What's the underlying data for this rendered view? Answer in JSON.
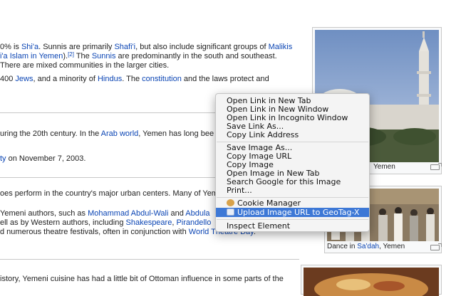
{
  "article": {
    "religion": {
      "l1_a": "0% is ",
      "l1_shia": "Shi'a",
      "l1_b": ". Sunnis are primarily ",
      "l1_shafii": "Shafi'i",
      "l1_c": ", but also include significant groups of ",
      "l1_malikis": "Malikis",
      "l2_link": "i'a Islam in Yemen",
      "l2_a": ").",
      "l2_ref": "[2]",
      "l2_b": " The ",
      "l2_sunnis": "Sunnis",
      "l2_c": " are predominantly in the south and southeast.",
      "l3": "There are mixed communities in the larger cities.",
      "l4_a": " 400 ",
      "l4_jews": "Jews",
      "l4_b": ", and a minority of ",
      "l4_hindus": "Hindus",
      "l4_c": ". The ",
      "l4_constitution": "constitution",
      "l4_d": " and the laws protect and"
    },
    "media": {
      "l1_a": "uring the 20th century. In the ",
      "l1_arab": "Arab world",
      "l1_b": ", Yemen has long bee",
      "l2_link": "ty",
      "l2_a": " on November 7, 2003."
    },
    "theatre": {
      "l1": "oes perform in the country's major urban centers. Many of Yem",
      "l2_a": "Yemeni authors, such as ",
      "l2_link": "Mohammad Abdul-Wali",
      "l2_b": " and ",
      "l2_link2": "Abdula",
      "l3_a": "ell as by Western authors, including ",
      "l3_shakespeare": "Shakespeare",
      "l3_b": ", ",
      "l3_pirandello": "Pirandello",
      "l4_a": "d numerous theatre festivals, often in conjunction with ",
      "l4_link": "World Theatre Day",
      "l4_b": "."
    },
    "cuisine": {
      "l1": "istory, Yemeni cuisine has had a little bit of Ottoman influence in some parts of the"
    }
  },
  "figures": {
    "mosque_caption": "Yemen",
    "dance_caption_a": "Dance in ",
    "dance_caption_link": "Sa'dah",
    "dance_caption_b": ", Yemen"
  },
  "context_menu": {
    "group1": [
      "Open Link in New Tab",
      "Open Link in New Window",
      "Open Link in Incognito Window",
      "Save Link As...",
      "Copy Link Address"
    ],
    "group2": [
      "Save Image As...",
      "Copy Image URL",
      "Copy Image",
      "Open Image in New Tab",
      "Search Google for this Image",
      "Print..."
    ],
    "group3": [
      "Cookie Manager",
      "Upload Image URL to GeoTag-X"
    ],
    "group4": [
      "Inspect Element"
    ],
    "highlighted": "Upload Image URL to GeoTag-X"
  },
  "colors": {
    "link": "#0b45b4",
    "highlight": "#3d78d6",
    "rule": "#c8c8c8"
  }
}
